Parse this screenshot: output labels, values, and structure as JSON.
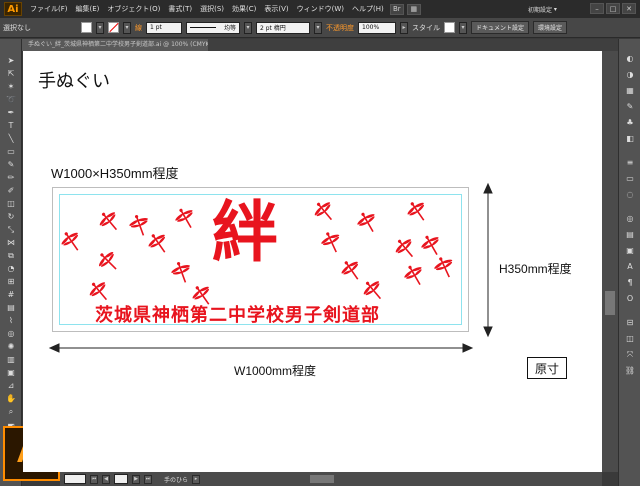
{
  "app": {
    "logo": "Ai"
  },
  "menu": [
    "ファイル(F)",
    "編集(E)",
    "オブジェクト(O)",
    "書式(T)",
    "選択(S)",
    "効果(C)",
    "表示(V)",
    "ウィンドウ(W)",
    "ヘルプ(H)"
  ],
  "workspace": "初期設定",
  "control": {
    "selection": "選択なし",
    "stroke_label": "線",
    "stroke_weight": "1 pt",
    "stroke_style": "均等",
    "brush": "2 pt 楕円",
    "opacity_label": "不透明度",
    "opacity_value": "100%",
    "style_label": "スタイル",
    "document_setup": "ドキュメント設定",
    "preferences": "環境設定"
  },
  "document": {
    "tab_title": "手ぬぐい_絆_茨城県神栖第二中学校男子剣道部.ai @ 100% (CMYK/プレビュー)"
  },
  "artboard": {
    "title": "手ぬぐい",
    "size_note": "W1000×H350mm程度",
    "height_note": "H350mm程度",
    "width_note": "W1000mm程度",
    "actual_size": "原寸",
    "main_kanji": "絆",
    "team_name": "茨城県神栖第二中学校男子剣道部",
    "accent_color": "#e8141e"
  },
  "status": {
    "tool": "手のひら"
  }
}
